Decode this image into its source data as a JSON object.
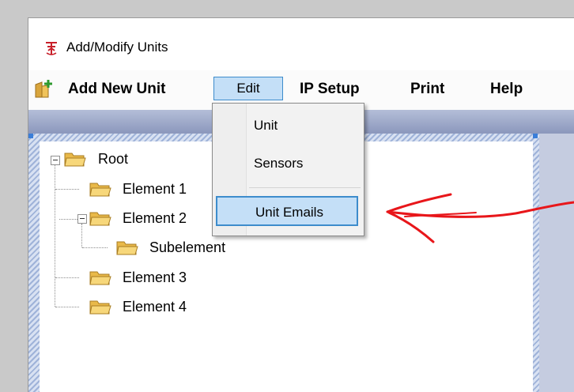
{
  "window": {
    "title": "Add/Modify Units",
    "icon": "app-logo-icon"
  },
  "menu": {
    "add_new_unit": "Add New Unit",
    "edit": "Edit",
    "ip_setup": "IP Setup",
    "print": "Print",
    "help": "Help"
  },
  "edit_menu": {
    "items": [
      "Unit",
      "Sensors",
      "Unit Emails"
    ],
    "highlighted": "Unit Emails"
  },
  "tree": {
    "root": "Root",
    "element1": "Element 1",
    "element2": "Element 2",
    "subelement": "Subelement",
    "element3": "Element 3",
    "element4": "Element 4"
  },
  "colors": {
    "highlight_fill": "#c4dff7",
    "highlight_border": "#3d8ccc",
    "annotation_arrow": "#e8161a",
    "folder": "#f2c95a"
  }
}
